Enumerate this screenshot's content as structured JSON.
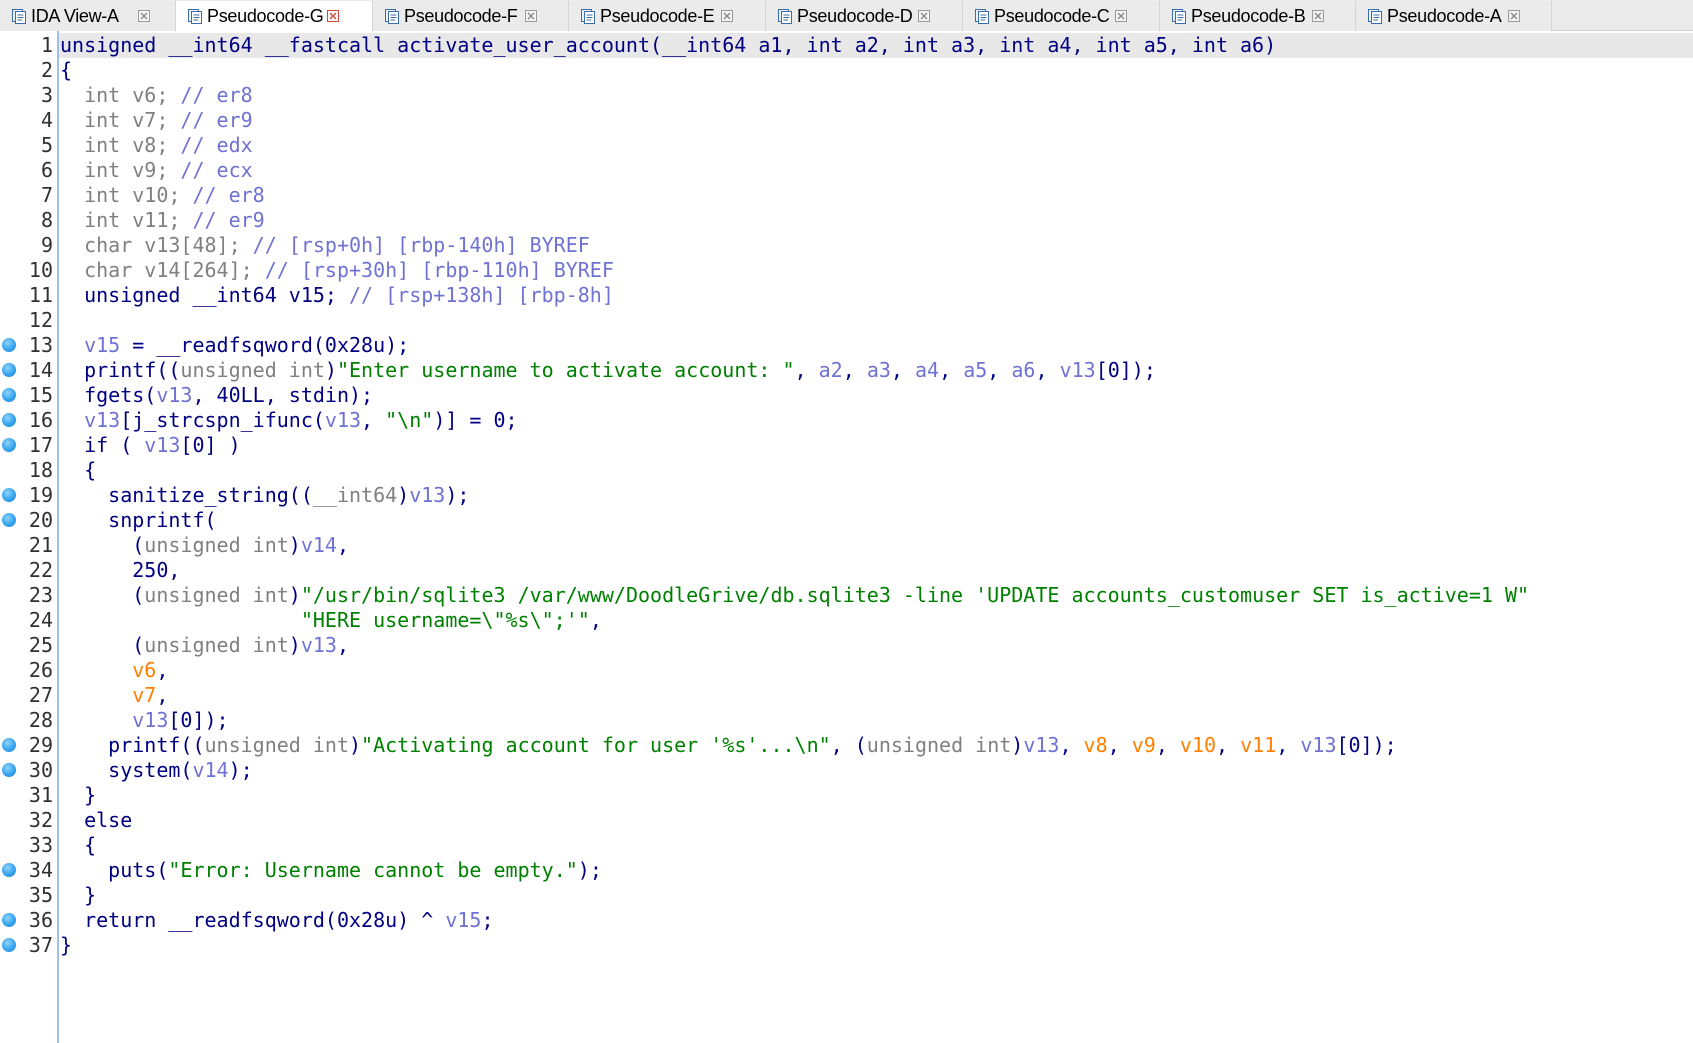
{
  "tabs": [
    {
      "label": "IDA View-A",
      "active": false
    },
    {
      "label": "Pseudocode-G",
      "active": true
    },
    {
      "label": "Pseudocode-F",
      "active": false
    },
    {
      "label": "Pseudocode-E",
      "active": false
    },
    {
      "label": "Pseudocode-D",
      "active": false
    },
    {
      "label": "Pseudocode-C",
      "active": false
    },
    {
      "label": "Pseudocode-B",
      "active": false
    },
    {
      "label": "Pseudocode-A",
      "active": false
    }
  ],
  "colors": {
    "keyword": "#000080",
    "type_gray": "#808080",
    "variable": "#2a2ab0",
    "string": "#008000",
    "orange_var": "#ff8000",
    "comment": "#6f72d3",
    "breakpoint": "#35a3ec",
    "current_line_bg": "#e8e8e8"
  },
  "code": {
    "lines": [
      {
        "n": "1",
        "bp": false,
        "segs": [
          [
            "k",
            "unsigned __int64 __fastcall activate_user_account(__int64 a1, int a2, int a3, int a4, int a5, int a6)"
          ]
        ]
      },
      {
        "n": "2",
        "bp": false,
        "segs": [
          [
            "k",
            "{"
          ]
        ]
      },
      {
        "n": "3",
        "bp": false,
        "segs": [
          [
            "g",
            "  int v6; "
          ],
          [
            "a",
            "// er8"
          ]
        ]
      },
      {
        "n": "4",
        "bp": false,
        "segs": [
          [
            "g",
            "  int v7; "
          ],
          [
            "a",
            "// er9"
          ]
        ]
      },
      {
        "n": "5",
        "bp": false,
        "segs": [
          [
            "g",
            "  int v8; "
          ],
          [
            "a",
            "// edx"
          ]
        ]
      },
      {
        "n": "6",
        "bp": false,
        "segs": [
          [
            "g",
            "  int v9; "
          ],
          [
            "a",
            "// ecx"
          ]
        ]
      },
      {
        "n": "7",
        "bp": false,
        "segs": [
          [
            "g",
            "  int v10; "
          ],
          [
            "a",
            "// er8"
          ]
        ]
      },
      {
        "n": "8",
        "bp": false,
        "segs": [
          [
            "g",
            "  int v11; "
          ],
          [
            "a",
            "// er9"
          ]
        ]
      },
      {
        "n": "9",
        "bp": false,
        "segs": [
          [
            "g",
            "  char v13[48]; "
          ],
          [
            "a",
            "// [rsp+0h] [rbp-140h] BYREF"
          ]
        ]
      },
      {
        "n": "10",
        "bp": false,
        "segs": [
          [
            "g",
            "  char v14[264]; "
          ],
          [
            "a",
            "// [rsp+30h] [rbp-110h] BYREF"
          ]
        ]
      },
      {
        "n": "11",
        "bp": false,
        "segs": [
          [
            "k",
            "  unsigned __int64 v15; "
          ],
          [
            "a",
            "// [rsp+138h] [rbp-8h]"
          ]
        ]
      },
      {
        "n": "12",
        "bp": false,
        "segs": []
      },
      {
        "n": "13",
        "bp": true,
        "segs": [
          [
            "k",
            "  "
          ],
          [
            "a",
            "v15"
          ],
          [
            "k",
            " = __readfsqword(0x28u);"
          ]
        ]
      },
      {
        "n": "14",
        "bp": true,
        "segs": [
          [
            "k",
            "  printf(("
          ],
          [
            "g",
            "unsigned int"
          ],
          [
            "k",
            ")"
          ],
          [
            "s",
            "\"Enter username to activate account: \""
          ],
          [
            "k",
            ", "
          ],
          [
            "a",
            "a2"
          ],
          [
            "k",
            ", "
          ],
          [
            "a",
            "a3"
          ],
          [
            "k",
            ", "
          ],
          [
            "a",
            "a4"
          ],
          [
            "k",
            ", "
          ],
          [
            "a",
            "a5"
          ],
          [
            "k",
            ", "
          ],
          [
            "a",
            "a6"
          ],
          [
            "k",
            ", "
          ],
          [
            "a",
            "v13"
          ],
          [
            "k",
            "[0]);"
          ]
        ]
      },
      {
        "n": "15",
        "bp": true,
        "segs": [
          [
            "k",
            "  fgets("
          ],
          [
            "a",
            "v13"
          ],
          [
            "k",
            ", 40LL, stdin);"
          ]
        ]
      },
      {
        "n": "16",
        "bp": true,
        "segs": [
          [
            "k",
            "  "
          ],
          [
            "a",
            "v13"
          ],
          [
            "k",
            "[j_strcspn_ifunc("
          ],
          [
            "a",
            "v13"
          ],
          [
            "k",
            ", "
          ],
          [
            "s",
            "\"\\n\""
          ],
          [
            "k",
            ")] = 0;"
          ]
        ]
      },
      {
        "n": "17",
        "bp": true,
        "segs": [
          [
            "k",
            "  if ( "
          ],
          [
            "a",
            "v13"
          ],
          [
            "k",
            "[0] )"
          ]
        ]
      },
      {
        "n": "18",
        "bp": false,
        "segs": [
          [
            "k",
            "  {"
          ]
        ]
      },
      {
        "n": "19",
        "bp": true,
        "segs": [
          [
            "k",
            "    sanitize_string(("
          ],
          [
            "g",
            "__int64"
          ],
          [
            "k",
            ")"
          ],
          [
            "a",
            "v13"
          ],
          [
            "k",
            ");"
          ]
        ]
      },
      {
        "n": "20",
        "bp": true,
        "segs": [
          [
            "k",
            "    snprintf("
          ]
        ]
      },
      {
        "n": "21",
        "bp": false,
        "segs": [
          [
            "k",
            "      ("
          ],
          [
            "g",
            "unsigned int"
          ],
          [
            "k",
            ")"
          ],
          [
            "a",
            "v14"
          ],
          [
            "k",
            ","
          ]
        ]
      },
      {
        "n": "22",
        "bp": false,
        "segs": [
          [
            "k",
            "      250,"
          ]
        ]
      },
      {
        "n": "23",
        "bp": false,
        "segs": [
          [
            "k",
            "      ("
          ],
          [
            "g",
            "unsigned int"
          ],
          [
            "k",
            ")"
          ],
          [
            "s",
            "\"/usr/bin/sqlite3 /var/www/DoodleGrive/db.sqlite3 -line 'UPDATE accounts_customuser SET is_active=1 W\""
          ]
        ]
      },
      {
        "n": "24",
        "bp": false,
        "segs": [
          [
            "s",
            "                    \"HERE username=\\\"%s\\\";'\""
          ],
          [
            "k",
            ","
          ]
        ]
      },
      {
        "n": "25",
        "bp": false,
        "segs": [
          [
            "k",
            "      ("
          ],
          [
            "g",
            "unsigned int"
          ],
          [
            "k",
            ")"
          ],
          [
            "a",
            "v13"
          ],
          [
            "k",
            ","
          ]
        ]
      },
      {
        "n": "26",
        "bp": false,
        "segs": [
          [
            "k",
            "      "
          ],
          [
            "o",
            "v6"
          ],
          [
            "k",
            ","
          ]
        ]
      },
      {
        "n": "27",
        "bp": false,
        "segs": [
          [
            "k",
            "      "
          ],
          [
            "o",
            "v7"
          ],
          [
            "k",
            ","
          ]
        ]
      },
      {
        "n": "28",
        "bp": false,
        "segs": [
          [
            "k",
            "      "
          ],
          [
            "a",
            "v13"
          ],
          [
            "k",
            "[0]);"
          ]
        ]
      },
      {
        "n": "29",
        "bp": true,
        "segs": [
          [
            "k",
            "    printf(("
          ],
          [
            "g",
            "unsigned int"
          ],
          [
            "k",
            ")"
          ],
          [
            "s",
            "\"Activating account for user '%s'...\\n\""
          ],
          [
            "k",
            ", ("
          ],
          [
            "g",
            "unsigned int"
          ],
          [
            "k",
            ")"
          ],
          [
            "a",
            "v13"
          ],
          [
            "k",
            ", "
          ],
          [
            "o",
            "v8"
          ],
          [
            "k",
            ", "
          ],
          [
            "o",
            "v9"
          ],
          [
            "k",
            ", "
          ],
          [
            "o",
            "v10"
          ],
          [
            "k",
            ", "
          ],
          [
            "o",
            "v11"
          ],
          [
            "k",
            ", "
          ],
          [
            "a",
            "v13"
          ],
          [
            "k",
            "[0]);"
          ]
        ]
      },
      {
        "n": "30",
        "bp": true,
        "segs": [
          [
            "k",
            "    system("
          ],
          [
            "a",
            "v14"
          ],
          [
            "k",
            ");"
          ]
        ]
      },
      {
        "n": "31",
        "bp": false,
        "segs": [
          [
            "k",
            "  }"
          ]
        ]
      },
      {
        "n": "32",
        "bp": false,
        "segs": [
          [
            "k",
            "  else"
          ]
        ]
      },
      {
        "n": "33",
        "bp": false,
        "segs": [
          [
            "k",
            "  {"
          ]
        ]
      },
      {
        "n": "34",
        "bp": true,
        "segs": [
          [
            "k",
            "    puts("
          ],
          [
            "s",
            "\"Error: Username cannot be empty.\""
          ],
          [
            "k",
            ");"
          ]
        ]
      },
      {
        "n": "35",
        "bp": false,
        "segs": [
          [
            "k",
            "  }"
          ]
        ]
      },
      {
        "n": "36",
        "bp": true,
        "segs": [
          [
            "k",
            "  return __readfsqword(0x28u) ^ "
          ],
          [
            "a",
            "v15"
          ],
          [
            "k",
            ";"
          ]
        ]
      },
      {
        "n": "37",
        "bp": true,
        "segs": [
          [
            "k",
            "}"
          ]
        ]
      }
    ]
  }
}
